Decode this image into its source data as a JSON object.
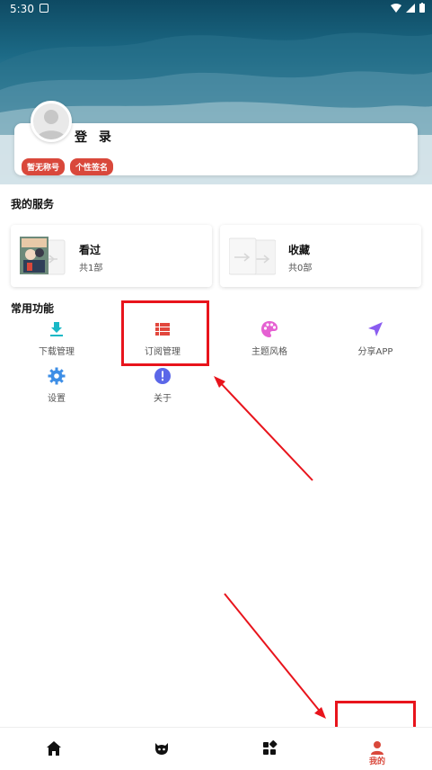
{
  "status_bar": {
    "time": "5:30"
  },
  "profile": {
    "login_label": "登 录",
    "tags": [
      "暂无称号",
      "个性签名"
    ]
  },
  "services": {
    "title": "我的服务",
    "items": [
      {
        "title": "看过",
        "count": "共1部"
      },
      {
        "title": "收藏",
        "count": "共0部"
      }
    ]
  },
  "features": {
    "title": "常用功能",
    "items": [
      {
        "label": "下载管理",
        "icon": "download-icon",
        "color": "#19b8c6"
      },
      {
        "label": "订阅管理",
        "icon": "list-icon",
        "color": "#e2473d"
      },
      {
        "label": "主题风格",
        "icon": "palette-icon",
        "color": "#e560d2"
      },
      {
        "label": "分享APP",
        "icon": "send-icon",
        "color": "#8a5cf0"
      },
      {
        "label": "设置",
        "icon": "gear-icon",
        "color": "#3d8ee6"
      },
      {
        "label": "关于",
        "icon": "info-icon",
        "color": "#5b67e8"
      }
    ]
  },
  "bottom_nav": {
    "items": [
      {
        "icon": "home-icon"
      },
      {
        "icon": "face-icon"
      },
      {
        "icon": "grid-icon"
      },
      {
        "icon": "person-icon",
        "label": "我的",
        "active": true
      }
    ]
  },
  "accent_color": "#d9483b",
  "annotation_color": "#e8141c"
}
